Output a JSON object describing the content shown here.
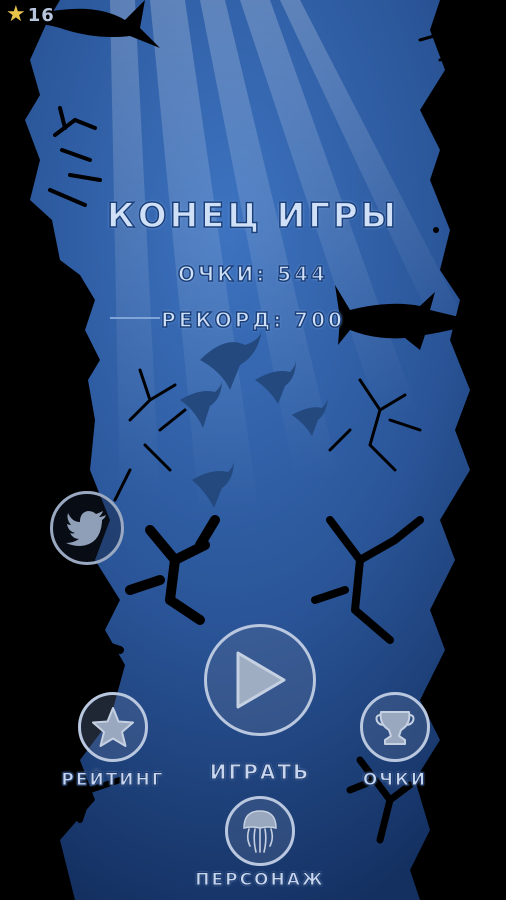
{
  "hud": {
    "stars_count": "16"
  },
  "game_over": {
    "title": "КОНЕЦ ИГРЫ",
    "score_line": "ОЧКИ: 544",
    "record_line": "РЕКОРД: 700"
  },
  "buttons": {
    "rating_label": "РЕЙТИНГ",
    "play_label": "ИГРАТЬ",
    "scores_label": "ОЧКИ",
    "character_label": "ПЕРСОНАЖ"
  },
  "colors": {
    "water": "#2f5fa8",
    "water_deep": "#163561",
    "silhouette": "#000000",
    "ui_text": "#cfe0f7",
    "star": "#e7c44a"
  },
  "icons": {
    "hud": "star-icon",
    "share": "twitter-bird-icon",
    "play": "play-triangle-icon",
    "rating": "star-icon",
    "scores": "trophy-icon",
    "character": "jellyfish-icon"
  }
}
